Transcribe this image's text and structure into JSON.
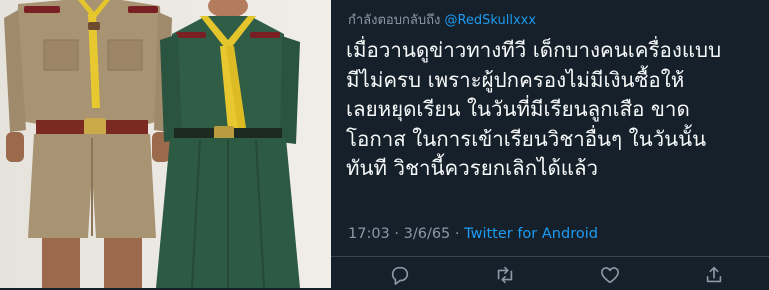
{
  "reply_context": {
    "prefix": "กำลังตอบกลับถึง",
    "handle": "@RedSkullxxx"
  },
  "tweet": {
    "lines": [
      "เมื่อวานดูข่าวทางทีวี เด็กบางคนเครื่องแบบ",
      "มีไม่ครบ เพราะผู้ปกครองไม่มีเงินซื้อให้",
      "เลยหยุดเรียน ในวันที่มีเรียนลูกเสือ ขาด",
      "โอกาส ในการเข้าเรียนวิชาอื่นๆ ในวันนั้น",
      "ทันที วิชานี้ควรยกเลิกได้แล้ว"
    ],
    "time": "17:03 · 3/6/65 · ",
    "source": "Twitter for Android"
  },
  "actions": {
    "reply_icon": "reply-icon",
    "retweet_icon": "retweet-icon",
    "like_icon": "heart-icon",
    "share_icon": "share-icon"
  },
  "colors": {
    "background": "#15202b",
    "text": "#f7f9f9",
    "muted": "#8b98a5",
    "link": "#1d9bf0"
  }
}
